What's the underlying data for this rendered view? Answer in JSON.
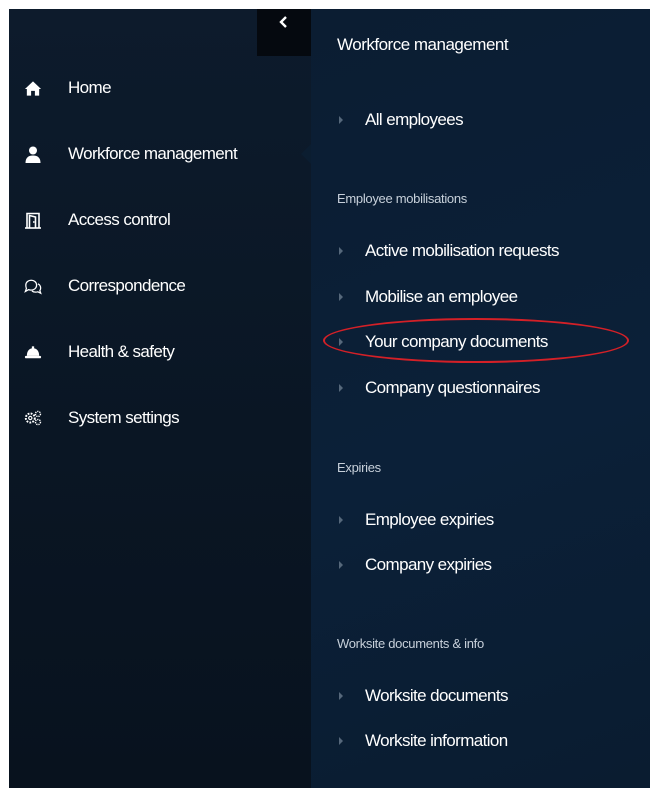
{
  "sidebar": {
    "collapse_icon": "chevron-left-icon",
    "items": [
      {
        "label": "Home",
        "icon": "home-icon"
      },
      {
        "label": "Workforce management",
        "icon": "user-icon",
        "active": true
      },
      {
        "label": "Access control",
        "icon": "door-icon"
      },
      {
        "label": "Correspondence",
        "icon": "chat-icon"
      },
      {
        "label": "Health & safety",
        "icon": "hard-hat-icon"
      },
      {
        "label": "System settings",
        "icon": "gears-icon"
      }
    ]
  },
  "submenu": {
    "title": "Workforce management",
    "top_items": [
      "All employees"
    ],
    "sections": [
      {
        "heading": "Employee mobilisations",
        "items": [
          "Active mobilisation requests",
          "Mobilise an employee",
          "Your company documents",
          "Company questionnaires"
        ]
      },
      {
        "heading": "Expiries",
        "items": [
          "Employee expiries",
          "Company expiries"
        ]
      },
      {
        "heading": "Worksite documents & info",
        "items": [
          "Worksite documents",
          "Worksite information"
        ]
      }
    ],
    "highlighted_item": "Your company documents"
  },
  "colors": {
    "sidebar_bg": "#0c1a2b",
    "submenu_bg": "#0b1e34",
    "highlight": "#d42027",
    "text": "#ffffff"
  }
}
